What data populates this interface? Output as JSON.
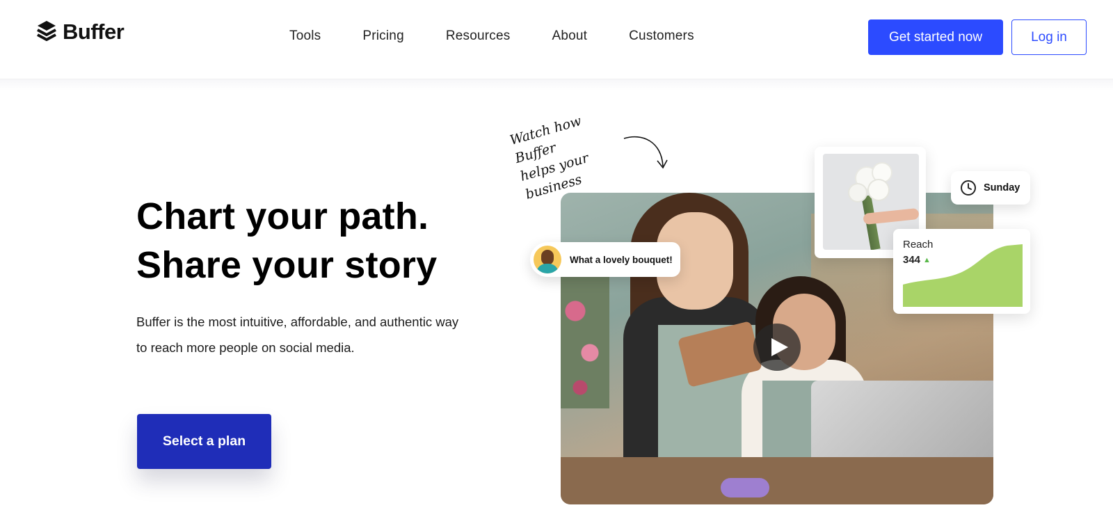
{
  "header": {
    "brand": "Buffer",
    "nav": [
      "Tools",
      "Pricing",
      "Resources",
      "About",
      "Customers"
    ],
    "cta_primary": "Get started now",
    "cta_secondary": "Log in"
  },
  "hero": {
    "title_line1": "Chart your path.",
    "title_line2": "Share your story",
    "subtitle": "Buffer is the most intuitive, affordable, and authentic way to reach more people on social media.",
    "cta": "Select a plan"
  },
  "visual": {
    "handwriting_line1": "Watch how Buffer",
    "handwriting_line2": "helps your business",
    "comment": "What a lovely bouquet!",
    "schedule_day": "Sunday",
    "reach_label": "Reach",
    "reach_value": "344",
    "reach_trend": "▲"
  },
  "colors": {
    "primary": "#2c4bff",
    "select_plan": "#1f2db8",
    "reach_area": "#a9d468",
    "trend_up": "#59b84a"
  }
}
